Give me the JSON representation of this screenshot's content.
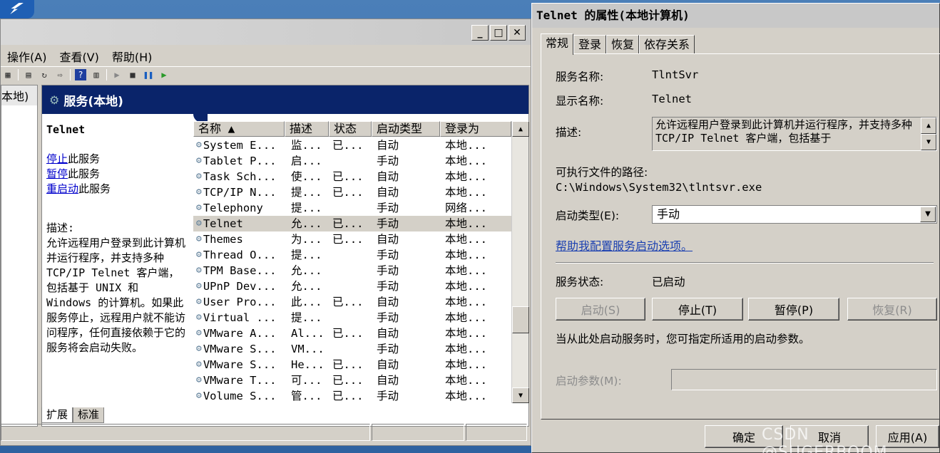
{
  "services_window": {
    "menu": [
      "操作(A)",
      "查看(V)",
      "帮助(H)"
    ],
    "minimize_label": "_",
    "maximize_label": "□",
    "close_label": "✕",
    "tree_item": "本地)",
    "panel_title": "服务(本地)",
    "selected_service": "Telnet",
    "links": {
      "stop": "停止",
      "stop_suffix": "此服务",
      "pause": "暂停",
      "pause_suffix": "此服务",
      "restart": "重启动",
      "restart_suffix": "此服务"
    },
    "description_label": "描述:",
    "description_text": "允许远程用户登录到此计算机并运行程序，并支持多种 TCP/IP Telnet 客户端，包括基于 UNIX 和 Windows 的计算机。如果此服务停止，远程用户就不能访问程序，任何直接依赖于它的服务将会启动失败。",
    "columns": [
      "名称 ▲",
      "描述",
      "状态",
      "启动类型",
      "登录为"
    ],
    "rows": [
      {
        "name": "System E...",
        "desc": "监...",
        "status": "已...",
        "startup": "自动",
        "logon": "本地..."
      },
      {
        "name": "Tablet P...",
        "desc": "启...",
        "status": "",
        "startup": "手动",
        "logon": "本地..."
      },
      {
        "name": "Task Sch...",
        "desc": "使...",
        "status": "已...",
        "startup": "自动",
        "logon": "本地..."
      },
      {
        "name": "TCP/IP N...",
        "desc": "提...",
        "status": "已...",
        "startup": "自动",
        "logon": "本地..."
      },
      {
        "name": "Telephony",
        "desc": "提...",
        "status": "",
        "startup": "手动",
        "logon": "网络..."
      },
      {
        "name": "Telnet",
        "desc": "允...",
        "status": "已...",
        "startup": "手动",
        "logon": "本地..."
      },
      {
        "name": "Themes",
        "desc": "为...",
        "status": "已...",
        "startup": "自动",
        "logon": "本地..."
      },
      {
        "name": "Thread O...",
        "desc": "提...",
        "status": "",
        "startup": "手动",
        "logon": "本地..."
      },
      {
        "name": "TPM Base...",
        "desc": "允...",
        "status": "",
        "startup": "手动",
        "logon": "本地..."
      },
      {
        "name": "UPnP Dev...",
        "desc": "允...",
        "status": "",
        "startup": "手动",
        "logon": "本地..."
      },
      {
        "name": "User Pro...",
        "desc": "此...",
        "status": "已...",
        "startup": "自动",
        "logon": "本地..."
      },
      {
        "name": "Virtual ...",
        "desc": "提...",
        "status": "",
        "startup": "手动",
        "logon": "本地..."
      },
      {
        "name": "VMware A...",
        "desc": "Al...",
        "status": "已...",
        "startup": "自动",
        "logon": "本地..."
      },
      {
        "name": "VMware S...",
        "desc": "VM...",
        "status": "",
        "startup": "手动",
        "logon": "本地..."
      },
      {
        "name": "VMware S...",
        "desc": "He...",
        "status": "已...",
        "startup": "自动",
        "logon": "本地..."
      },
      {
        "name": "VMware T...",
        "desc": "可...",
        "status": "已...",
        "startup": "自动",
        "logon": "本地..."
      },
      {
        "name": "Volume S...",
        "desc": "管...",
        "status": "已...",
        "startup": "手动",
        "logon": "本地..."
      }
    ],
    "selected_row_index": 5,
    "bottom_tabs": [
      "扩展",
      "标准"
    ]
  },
  "dialog": {
    "title": "Telnet 的属性(本地计算机)",
    "tabs": [
      "常规",
      "登录",
      "恢复",
      "依存关系"
    ],
    "service_name_label": "服务名称:",
    "service_name": "TlntSvr",
    "display_name_label": "显示名称:",
    "display_name": "Telnet",
    "description_label": "描述:",
    "description": "允许远程用户登录到此计算机并运行程序，并支持多种 TCP/IP Telnet 客户端，包括基于",
    "path_label": "可执行文件的路径:",
    "path": "C:\\Windows\\System32\\tlntsvr.exe",
    "startup_type_label": "启动类型(E):",
    "startup_type": "手动",
    "help_link": "帮助我配置服务启动选项。",
    "status_label": "服务状态:",
    "status": "已启动",
    "buttons": {
      "start": "启动(S)",
      "stop": "停止(T)",
      "pause": "暂停(P)",
      "resume": "恢复(R)"
    },
    "hint": "当从此处启动服务时，您可指定所适用的启动参数。",
    "param_label": "启动参数(M):",
    "param_value": "",
    "ok": "确定",
    "cancel": "取消",
    "apply": "应用(A)"
  },
  "watermark": "CSDN @SUGERBOOM"
}
